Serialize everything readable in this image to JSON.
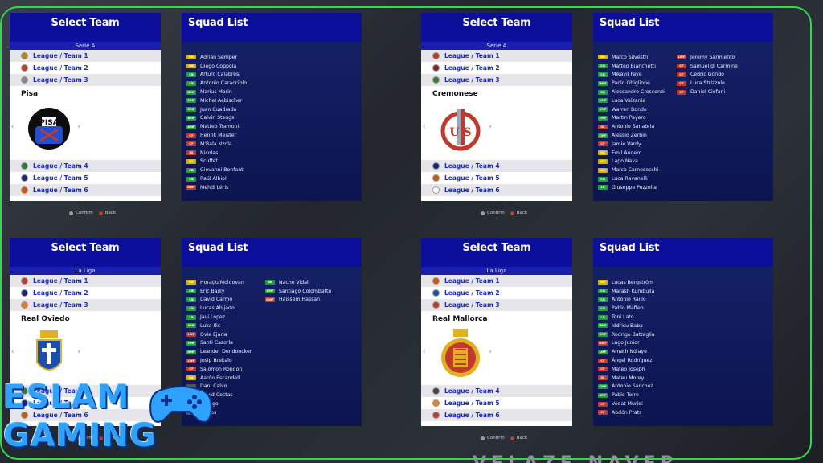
{
  "header_label": "Select Team",
  "squad_label": "Squad List",
  "footer": {
    "confirm": "Confirm",
    "back": "Back"
  },
  "branding": {
    "line1": "ESLAM",
    "line2": "GAMING"
  },
  "bottom_text": "VELAZE NAVER",
  "position_colors": {
    "GK": "#d6b200",
    "CB": "#1f9f3a",
    "RB": "#1f9f3a",
    "LB": "#1f9f3a",
    "DMF": "#1f9f3a",
    "CMF": "#1f9f3a",
    "AMF": "#1f9f3a",
    "LMF": "#1f9f3a",
    "RMF": "#1f9f3a",
    "SS": "#c0392b",
    "CF": "#c0392b",
    "LWF": "#c0392b",
    "RWF": "#c0392b"
  },
  "panels": [
    {
      "league": "Serie A",
      "teams_top": [
        {
          "label": "League / Team 1",
          "color": "#b8860b"
        },
        {
          "label": "League / Team 2",
          "color": "#c0392b"
        },
        {
          "label": "League / Team 3",
          "color": "#888888"
        }
      ],
      "teams_bottom": [
        {
          "label": "League / Team 4",
          "color": "#2e7d32"
        },
        {
          "label": "League / Team 5",
          "color": "#1a237e"
        },
        {
          "label": "League / Team 6",
          "color": "#d35400"
        }
      ],
      "team_name": "Pisa",
      "crest": "pisa-crest-icon",
      "squad": [
        [
          {
            "pos": "GK",
            "name": "Adrian Semper"
          },
          {
            "pos": "GK",
            "name": "Diego Coppola"
          },
          {
            "pos": "CB",
            "name": "Arturo Calabresi"
          },
          {
            "pos": "CB",
            "name": "Antonio Caracciolo"
          },
          {
            "pos": "DMF",
            "name": "Marius Marin"
          },
          {
            "pos": "CMF",
            "name": "Michel Aebischer"
          },
          {
            "pos": "RMF",
            "name": "Juan Cuadrado"
          },
          {
            "pos": "AMF",
            "name": "Calvin Stengs"
          },
          {
            "pos": "AMF",
            "name": "Matteo Tramoni"
          },
          {
            "pos": "CF",
            "name": "Henrik Meister"
          },
          {
            "pos": "CF",
            "name": "M'Bala Nzola"
          },
          {
            "pos": "SS",
            "name": "Nicolas"
          },
          {
            "pos": "GK",
            "name": "Scuffet"
          },
          {
            "pos": "CB",
            "name": "Giovanni Bonfanti"
          },
          {
            "pos": "CB",
            "name": "Raúl Albiol"
          },
          {
            "pos": "RWF",
            "name": "Mehdi Léris"
          }
        ],
        []
      ]
    },
    {
      "league": "Serie A",
      "teams_top": [
        {
          "label": "League / Team 1",
          "color": "#c0392b"
        },
        {
          "label": "League / Team 2",
          "color": "#8e2020"
        },
        {
          "label": "League / Team 3",
          "color": "#2e7d32"
        }
      ],
      "teams_bottom": [
        {
          "label": "League / Team 4",
          "color": "#1a237e"
        },
        {
          "label": "League / Team 5",
          "color": "#d35400"
        },
        {
          "label": "League / Team 6",
          "color": "#ffffff"
        }
      ],
      "team_name": "Cremonese",
      "crest": "cremonese-crest-icon",
      "squad": [
        [
          {
            "pos": "GK",
            "name": "Marco Silvestri"
          },
          {
            "pos": "CB",
            "name": "Matteo Bianchetti"
          },
          {
            "pos": "CB",
            "name": "Mikayil Faye"
          },
          {
            "pos": "DMF",
            "name": "Paolo Ghiglione"
          },
          {
            "pos": "RB",
            "name": "Alessandro Crescenzi"
          },
          {
            "pos": "CMF",
            "name": "Luca Valzania"
          },
          {
            "pos": "CMF",
            "name": "Warren Bondo"
          },
          {
            "pos": "CMF",
            "name": "Martín Payero"
          },
          {
            "pos": "SS",
            "name": "Antonio Sanabria"
          },
          {
            "pos": "CMF",
            "name": "Alessio Zerbin"
          },
          {
            "pos": "CF",
            "name": "Jamie Vardy"
          },
          {
            "pos": "GK",
            "name": "Emil Audero"
          },
          {
            "pos": "GK",
            "name": "Lapo Nava"
          },
          {
            "pos": "GK",
            "name": "Marco Carnesecchi"
          },
          {
            "pos": "CB",
            "name": "Luca Ravanelli"
          },
          {
            "pos": "LB",
            "name": "Giuseppe Pezzella"
          }
        ],
        [
          {
            "pos": "LWF",
            "name": "Jeremy Sarmiento"
          },
          {
            "pos": "CF",
            "name": "Samuel di Carmine"
          },
          {
            "pos": "CF",
            "name": "Cedric Gondo"
          },
          {
            "pos": "CF",
            "name": "Luca Strizzolo"
          },
          {
            "pos": "CF",
            "name": "Daniel Ciofani"
          }
        ]
      ]
    },
    {
      "league": "La Liga",
      "teams_top": [
        {
          "label": "League / Team 1",
          "color": "#c0392b"
        },
        {
          "label": "League / Team 2",
          "color": "#1a237e"
        },
        {
          "label": "League / Team 3",
          "color": "#e67e22"
        }
      ],
      "teams_bottom": [
        {
          "label": "League / Team 4",
          "color": "#2e7d32"
        },
        {
          "label": "League / Team 5",
          "color": "#1a237e"
        },
        {
          "label": "League / Team 6",
          "color": "#d35400"
        }
      ],
      "team_name": "Real Oviedo",
      "crest": "real-oviedo-crest-icon",
      "squad": [
        [
          {
            "pos": "GK",
            "name": "Horaţiu Moldovan"
          },
          {
            "pos": "CB",
            "name": "Eric Bailly"
          },
          {
            "pos": "CB",
            "name": "David Carmo"
          },
          {
            "pos": "CB",
            "name": "Lucas Ahijado"
          },
          {
            "pos": "LB",
            "name": "Javi López"
          },
          {
            "pos": "AMF",
            "name": "Luka Ilic"
          },
          {
            "pos": "LWF",
            "name": "Ovie Ejaria"
          },
          {
            "pos": "CMF",
            "name": "Santi Cazorla"
          },
          {
            "pos": "DMF",
            "name": "Leander Dendoncker"
          },
          {
            "pos": "LWF",
            "name": "Josip Brekalo"
          },
          {
            "pos": "CF",
            "name": "Salomón Rondón"
          },
          {
            "pos": "GK",
            "name": "Aarón Escandell"
          },
          {
            "pos": "",
            "name": "Dani Calvo"
          },
          {
            "pos": "",
            "name": "David Costas"
          },
          {
            "pos": "",
            "name": "Luengo"
          },
          {
            "pos": "",
            "name": "Lemos"
          }
        ],
        [
          {
            "pos": "RB",
            "name": "Nacho Vidal"
          },
          {
            "pos": "CMF",
            "name": "Santiago Colombatto"
          },
          {
            "pos": "RWF",
            "name": "Haissem Hassan"
          }
        ]
      ]
    },
    {
      "league": "La Liga",
      "teams_top": [
        {
          "label": "League / Team 1",
          "color": "#d35400"
        },
        {
          "label": "League / Team 2",
          "color": "#1a4fb0"
        },
        {
          "label": "League / Team 3",
          "color": "#c0392b"
        }
      ],
      "teams_bottom": [
        {
          "label": "League / Team 4",
          "color": "#444444"
        },
        {
          "label": "League / Team 5",
          "color": "#e67e22"
        },
        {
          "label": "League / Team 6",
          "color": "#c0392b"
        }
      ],
      "team_name": "Real Mallorca",
      "crest": "real-mallorca-crest-icon",
      "squad": [
        [
          {
            "pos": "GK",
            "name": "Lucas Bergström"
          },
          {
            "pos": "CB",
            "name": "Marash Kumbulla"
          },
          {
            "pos": "CB",
            "name": "Antonio Raíllo"
          },
          {
            "pos": "CB",
            "name": "Pablo Maffeo"
          },
          {
            "pos": "LB",
            "name": "Toni Lato"
          },
          {
            "pos": "DMF",
            "name": "Iddrisu Baba"
          },
          {
            "pos": "CMF",
            "name": "Rodrigo Battaglia"
          },
          {
            "pos": "RWF",
            "name": "Lago Junior"
          },
          {
            "pos": "LMF",
            "name": "Amath Ndiaye"
          },
          {
            "pos": "CF",
            "name": "Ángel Rodríguez"
          },
          {
            "pos": "CF",
            "name": "Mateo Joseph"
          },
          {
            "pos": "SS",
            "name": "Mateu Morey"
          },
          {
            "pos": "CMF",
            "name": "Antonio Sánchez"
          },
          {
            "pos": "AMF",
            "name": "Pablo Torre"
          },
          {
            "pos": "CF",
            "name": "Vedat Muriqi"
          },
          {
            "pos": "CF",
            "name": "Abdón Prats"
          }
        ],
        []
      ]
    }
  ]
}
